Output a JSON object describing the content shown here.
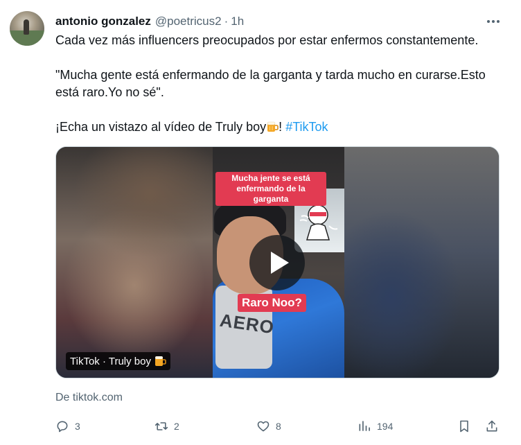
{
  "tweet": {
    "display_name": "antonio gonzalez",
    "handle": "@poetricus2",
    "separator": "·",
    "time": "1h",
    "text_line1": "Cada vez más influencers preocupados por estar enfermos constantemente.",
    "text_quote": "\"Mucha gente está enfermando de la garganta y tarda mucho en curarse.Esto está raro.Yo no sé\".",
    "text_cta": "¡Echa un vistazo al vídeo de Truly boy",
    "text_cta_end": "! ",
    "hashtag": "#TikTok"
  },
  "media": {
    "caption_top": "Mucha jente se está enfermando de la garganta",
    "caption_bottom": "Raro Noo?",
    "shirt_text": "AERO",
    "badge": "TikTok · Truly boy",
    "source": "De tiktok.com"
  },
  "actions": {
    "replies": "3",
    "retweets": "2",
    "likes": "8",
    "views": "194"
  },
  "icons": {
    "more": "more-icon",
    "reply": "reply-icon",
    "retweet": "retweet-icon",
    "like": "heart-icon",
    "views": "views-icon",
    "bookmark": "bookmark-icon",
    "share": "share-icon",
    "play": "play-icon",
    "beer": "beer-emoji-icon"
  },
  "colors": {
    "text": "#0f1419",
    "secondary": "#536471",
    "link": "#1d9bf0",
    "caption_red": "#e23b52"
  }
}
